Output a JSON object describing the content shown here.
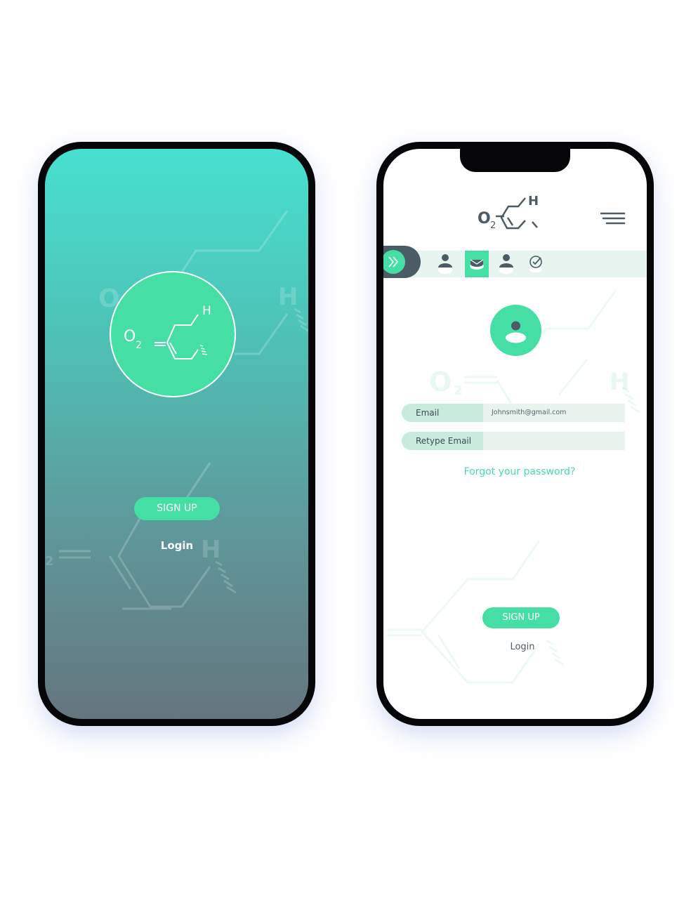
{
  "splash": {
    "logo": {
      "o2": "O",
      "o2_sub": "2",
      "h": "H"
    },
    "bg_symbols": {
      "o2": "O",
      "o2_sub": "2",
      "h": "H"
    },
    "signup_label": "SIGN UP",
    "login_label": "Login"
  },
  "signup_screen": {
    "logo": {
      "o2": "O",
      "o2_sub": "2",
      "h": "H"
    },
    "bg_symbols": {
      "o2": "O",
      "o2_sub": "2",
      "h": "H"
    },
    "menu_icon": "hamburger-icon",
    "steps": [
      {
        "icon": "user-icon",
        "active": false
      },
      {
        "icon": "mail-icon",
        "active": true
      },
      {
        "icon": "user-icon",
        "active": false
      },
      {
        "icon": "check-circle-icon",
        "active": false
      }
    ],
    "fields": {
      "email": {
        "label": "Email",
        "value": "Johnsmith@gmail.com"
      },
      "retype_email": {
        "label": "Retype Email",
        "value": ""
      }
    },
    "forgot_password": "Forgot your password?",
    "signup_label": "SIGN UP",
    "login_label": "Login"
  },
  "colors": {
    "accent": "#45dea5",
    "dark": "#4c5c66",
    "valid_marker": "#45dea5",
    "invalid_marker": "#e57373"
  }
}
